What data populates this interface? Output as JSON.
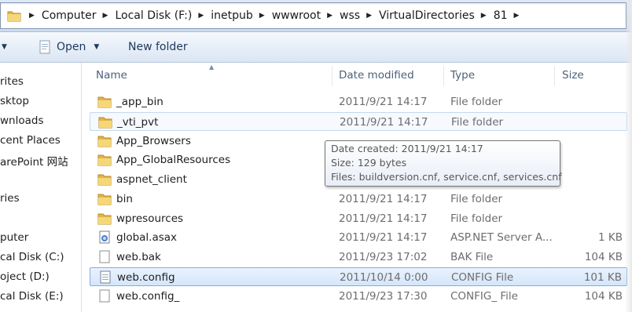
{
  "address": {
    "crumbs": [
      "Computer",
      "Local Disk (F:)",
      "inetpub",
      "wwwroot",
      "wss",
      "VirtualDirectories",
      "81"
    ]
  },
  "toolbar": {
    "open_label": "Open",
    "new_folder_label": "New folder"
  },
  "nav": {
    "items": [
      "rites",
      "sktop",
      "wnloads",
      "cent Places",
      "arePoint 网站",
      "ries",
      "puter",
      "cal Disk (C:)",
      "oject (D:)",
      "cal Disk (E:)"
    ]
  },
  "columns": {
    "name": "Name",
    "date": "Date modified",
    "type": "Type",
    "size": "Size"
  },
  "files": [
    {
      "name": "_app_bin",
      "date": "2011/9/21 14:17",
      "type": "File folder",
      "size": "",
      "icon": "folder-icon"
    },
    {
      "name": "_vti_pvt",
      "date": "2011/9/21 14:17",
      "type": "File folder",
      "size": "",
      "icon": "folder-icon"
    },
    {
      "name": "App_Browsers",
      "date": "",
      "type": "",
      "size": "",
      "icon": "folder-icon"
    },
    {
      "name": "App_GlobalResources",
      "date": "",
      "type": "",
      "size": "",
      "icon": "folder-icon"
    },
    {
      "name": "aspnet_client",
      "date": "",
      "type": "",
      "size": "",
      "icon": "folder-icon"
    },
    {
      "name": "bin",
      "date": "2011/9/21 14:17",
      "type": "File folder",
      "size": "",
      "icon": "folder-icon"
    },
    {
      "name": "wpresources",
      "date": "2011/9/21 14:17",
      "type": "File folder",
      "size": "",
      "icon": "folder-icon"
    },
    {
      "name": "global.asax",
      "date": "2011/9/21 14:17",
      "type": "ASP.NET Server A...",
      "size": "1 KB",
      "icon": "aspx-file-icon"
    },
    {
      "name": "web.bak",
      "date": "2011/9/23 17:02",
      "type": "BAK File",
      "size": "104 KB",
      "icon": "file-icon"
    },
    {
      "name": "web.config",
      "date": "2011/10/14 0:00",
      "type": "CONFIG File",
      "size": "101 KB",
      "icon": "config-file-icon"
    },
    {
      "name": "web.config_",
      "date": "2011/9/23 17:30",
      "type": "CONFIG_ File",
      "size": "104 KB",
      "icon": "file-icon"
    }
  ],
  "tooltip": {
    "created": "Date created: 2011/9/21 14:17",
    "size": "Size: 129 bytes",
    "files": "Files: buildversion.cnf, service.cnf, services.cnf"
  },
  "colors": {
    "selection": "#d5e6fb",
    "selection_border": "#84acdd",
    "folder": "#e9c35a",
    "header_text": "#4c607a"
  }
}
